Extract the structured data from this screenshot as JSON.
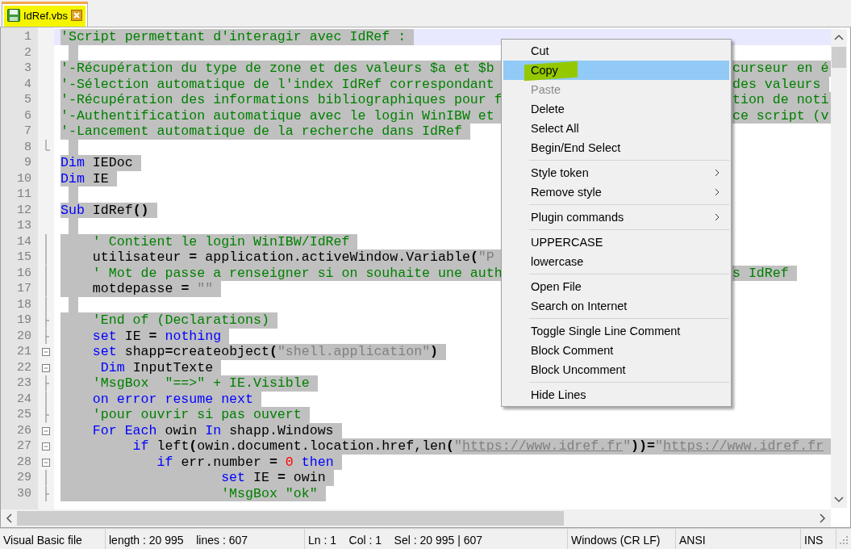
{
  "tabs": [
    {
      "label": "IdRef.vbs",
      "selected": true,
      "highlighted": true
    }
  ],
  "editor": {
    "selection_active": true,
    "lines": [
      {
        "number": "1",
        "current": true,
        "kind": "plain",
        "left": [
          {
            "kind": "comment",
            "text": "'Script permettant d'interagir avec IdRef :"
          }
        ]
      },
      {
        "number": "2",
        "current": false,
        "kind": "plain"
      },
      {
        "number": "3",
        "current": false,
        "kind": "plain",
        "left": [
          {
            "kind": "comment",
            "text": "'-Récupération du type de zone et des valeurs $a et $b"
          }
        ],
        "right": [
          {
            "kind": "comment",
            "text": "curseur en é"
          }
        ]
      },
      {
        "number": "4",
        "current": false,
        "kind": "plain",
        "left": [
          {
            "kind": "comment",
            "text": "'-Sélection automatique de l'index IdRef correspondant"
          }
        ],
        "right": [
          {
            "kind": "comment",
            "text": "des valeurs"
          }
        ]
      },
      {
        "number": "5",
        "current": false,
        "kind": "plain",
        "left": [
          {
            "kind": "comment",
            "text": "'-Récupération des informations bibliographiques pour f"
          }
        ],
        "right": [
          {
            "kind": "comment",
            "text": "tion de noti"
          }
        ]
      },
      {
        "number": "6",
        "current": false,
        "kind": "plain",
        "left": [
          {
            "kind": "comment",
            "text": "'-Authentification automatique avec le login WinIBW et"
          }
        ],
        "right": [
          {
            "kind": "comment",
            "text": "ce script (v"
          }
        ]
      },
      {
        "number": "7",
        "current": false,
        "kind": "plain",
        "left": [
          {
            "kind": "comment",
            "text": "'-Lancement automatique de la recherche dans IdRef"
          }
        ]
      },
      {
        "number": "8",
        "current": false,
        "kind": "fold-end"
      },
      {
        "number": "9",
        "current": false,
        "kind": "plain",
        "left": [
          {
            "kind": "keyword",
            "text": "Dim"
          },
          {
            "kind": "plain",
            "text": " IEDoc"
          }
        ]
      },
      {
        "number": "10",
        "current": false,
        "kind": "plain",
        "left": [
          {
            "kind": "keyword",
            "text": "Dim"
          },
          {
            "kind": "plain",
            "text": " IE"
          }
        ]
      },
      {
        "number": "11",
        "current": false,
        "kind": "plain"
      },
      {
        "number": "12",
        "current": false,
        "kind": "plain",
        "left": [
          {
            "kind": "keyword",
            "text": "Sub"
          },
          {
            "kind": "plain",
            "text": " IdRef"
          },
          {
            "kind": "op",
            "text": "()"
          }
        ]
      },
      {
        "number": "13",
        "current": false,
        "kind": "plain"
      },
      {
        "number": "14",
        "current": false,
        "kind": "fold-body",
        "left": [
          {
            "kind": "comment",
            "text": "    ' Contient le login WinIBW/IdRef"
          }
        ]
      },
      {
        "number": "15",
        "current": false,
        "kind": "fold-body",
        "left": [
          {
            "kind": "plain",
            "text": "    utilisateur "
          },
          {
            "kind": "op",
            "text": "="
          },
          {
            "kind": "plain",
            "text": " application.activeWindow.Variable"
          },
          {
            "kind": "op",
            "text": "("
          },
          {
            "kind": "string",
            "text": "\"P"
          }
        ]
      },
      {
        "number": "16",
        "current": false,
        "kind": "fold-body",
        "left": [
          {
            "kind": "comment",
            "text": "    ' Mot de passe a renseigner si on souhaite une auth"
          }
        ],
        "right": [
          {
            "kind": "comment",
            "text": "s IdRef"
          }
        ]
      },
      {
        "number": "17",
        "current": false,
        "kind": "fold-body",
        "left": [
          {
            "kind": "plain",
            "text": "    motdepasse "
          },
          {
            "kind": "op",
            "text": "="
          },
          {
            "kind": "string",
            "text": " \"\""
          }
        ]
      },
      {
        "number": "18",
        "current": false,
        "kind": "fold-body"
      },
      {
        "number": "19",
        "current": false,
        "kind": "fold-branch",
        "left": [
          {
            "kind": "comment",
            "text": "    'End of (Declarations)"
          }
        ]
      },
      {
        "number": "20",
        "current": false,
        "kind": "fold-branch",
        "left": [
          {
            "kind": "keyword",
            "text": "    set"
          },
          {
            "kind": "plain",
            "text": " IE "
          },
          {
            "kind": "op",
            "text": "="
          },
          {
            "kind": "keyword",
            "text": " nothing"
          }
        ]
      },
      {
        "number": "21",
        "current": false,
        "kind": "fold-start",
        "left": [
          {
            "kind": "keyword",
            "text": "    set"
          },
          {
            "kind": "plain",
            "text": " shapp"
          },
          {
            "kind": "op",
            "text": "="
          },
          {
            "kind": "plain",
            "text": "createobject"
          },
          {
            "kind": "op",
            "text": "("
          },
          {
            "kind": "string",
            "text": "\"shell.application\""
          },
          {
            "kind": "op",
            "text": ")"
          }
        ]
      },
      {
        "number": "22",
        "current": false,
        "kind": "fold-start",
        "left": [
          {
            "kind": "keyword",
            "text": "     Dim"
          },
          {
            "kind": "plain",
            "text": " InputTexte"
          }
        ]
      },
      {
        "number": "23",
        "current": false,
        "kind": "fold-branch",
        "left": [
          {
            "kind": "comment",
            "text": "    'MsgBox  \"==>\" + IE.Visible"
          }
        ]
      },
      {
        "number": "24",
        "current": false,
        "kind": "fold-body",
        "left": [
          {
            "kind": "keyword",
            "text": "    on error resume next"
          }
        ]
      },
      {
        "number": "25",
        "current": false,
        "kind": "fold-branch",
        "left": [
          {
            "kind": "comment",
            "text": "    'pour ouvrir si pas ouvert"
          }
        ]
      },
      {
        "number": "26",
        "current": false,
        "kind": "fold-start",
        "left": [
          {
            "kind": "keyword",
            "text": "    For Each"
          },
          {
            "kind": "plain",
            "text": " owin "
          },
          {
            "kind": "keyword",
            "text": "In"
          },
          {
            "kind": "plain",
            "text": " shapp.Windows"
          }
        ]
      },
      {
        "number": "27",
        "current": false,
        "kind": "fold-start",
        "left": [
          {
            "kind": "keyword",
            "text": "         if"
          },
          {
            "kind": "plain",
            "text": " left"
          },
          {
            "kind": "op",
            "text": "("
          },
          {
            "kind": "plain",
            "text": "owin.document.location.href,len"
          },
          {
            "kind": "op",
            "text": "("
          },
          {
            "kind": "string",
            "text": "\""
          },
          {
            "kind": "url",
            "text": "https://www.idref.fr"
          },
          {
            "kind": "string",
            "text": "\""
          },
          {
            "kind": "op",
            "text": "))="
          },
          {
            "kind": "string",
            "text": "\""
          },
          {
            "kind": "url",
            "text": "https://www.idref.fr"
          }
        ]
      },
      {
        "number": "28",
        "current": false,
        "kind": "fold-start",
        "left": [
          {
            "kind": "keyword",
            "text": "            if"
          },
          {
            "kind": "plain",
            "text": " err.number "
          },
          {
            "kind": "op",
            "text": "="
          },
          {
            "kind": "number",
            "text": " 0"
          },
          {
            "kind": "keyword",
            "text": " then"
          }
        ]
      },
      {
        "number": "29",
        "current": false,
        "kind": "fold-body",
        "left": [
          {
            "kind": "keyword",
            "text": "                    set"
          },
          {
            "kind": "plain",
            "text": " IE "
          },
          {
            "kind": "op",
            "text": "="
          },
          {
            "kind": "plain",
            "text": " owin"
          }
        ]
      },
      {
        "number": "30",
        "current": false,
        "kind": "fold-branch",
        "left": [
          {
            "kind": "comment",
            "text": "                    'MsgBox \"ok\""
          }
        ]
      }
    ]
  },
  "context_menu": {
    "items": [
      {
        "kind": "item",
        "label": "Cut",
        "disabled": false,
        "selected": false,
        "highlighted": false,
        "submenu": false
      },
      {
        "kind": "item",
        "label": "Copy",
        "disabled": false,
        "selected": true,
        "highlighted": true,
        "submenu": false
      },
      {
        "kind": "item",
        "label": "Paste",
        "disabled": true,
        "selected": false,
        "highlighted": false,
        "submenu": false
      },
      {
        "kind": "item",
        "label": "Delete",
        "disabled": false,
        "selected": false,
        "highlighted": false,
        "submenu": false
      },
      {
        "kind": "item",
        "label": "Select All",
        "disabled": false,
        "selected": false,
        "highlighted": false,
        "submenu": false
      },
      {
        "kind": "item",
        "label": "Begin/End Select",
        "disabled": false,
        "selected": false,
        "highlighted": false,
        "submenu": false
      },
      {
        "kind": "separator"
      },
      {
        "kind": "item",
        "label": "Style token",
        "disabled": false,
        "selected": false,
        "highlighted": false,
        "submenu": true
      },
      {
        "kind": "item",
        "label": "Remove style",
        "disabled": false,
        "selected": false,
        "highlighted": false,
        "submenu": true
      },
      {
        "kind": "separator"
      },
      {
        "kind": "item",
        "label": "Plugin commands",
        "disabled": false,
        "selected": false,
        "highlighted": false,
        "submenu": true
      },
      {
        "kind": "separator"
      },
      {
        "kind": "item",
        "label": "UPPERCASE",
        "disabled": false,
        "selected": false,
        "highlighted": false,
        "submenu": false
      },
      {
        "kind": "item",
        "label": "lowercase",
        "disabled": false,
        "selected": false,
        "highlighted": false,
        "submenu": false
      },
      {
        "kind": "separator"
      },
      {
        "kind": "item",
        "label": "Open File",
        "disabled": false,
        "selected": false,
        "highlighted": false,
        "submenu": false
      },
      {
        "kind": "item",
        "label": "Search on Internet",
        "disabled": false,
        "selected": false,
        "highlighted": false,
        "submenu": false
      },
      {
        "kind": "separator"
      },
      {
        "kind": "item",
        "label": "Toggle Single Line Comment",
        "disabled": false,
        "selected": false,
        "highlighted": false,
        "submenu": false
      },
      {
        "kind": "item",
        "label": "Block Comment",
        "disabled": false,
        "selected": false,
        "highlighted": false,
        "submenu": false
      },
      {
        "kind": "item",
        "label": "Block Uncomment",
        "disabled": false,
        "selected": false,
        "highlighted": false,
        "submenu": false
      },
      {
        "kind": "separator"
      },
      {
        "kind": "item",
        "label": "Hide Lines",
        "disabled": false,
        "selected": false,
        "highlighted": false,
        "submenu": false
      }
    ]
  },
  "status_bar": [
    "Visual Basic file",
    "length : 20 995    lines : 607",
    "Ln : 1    Col : 1    Sel : 20 995 | 607",
    "Windows (CR LF)",
    "ANSI",
    "INS"
  ]
}
